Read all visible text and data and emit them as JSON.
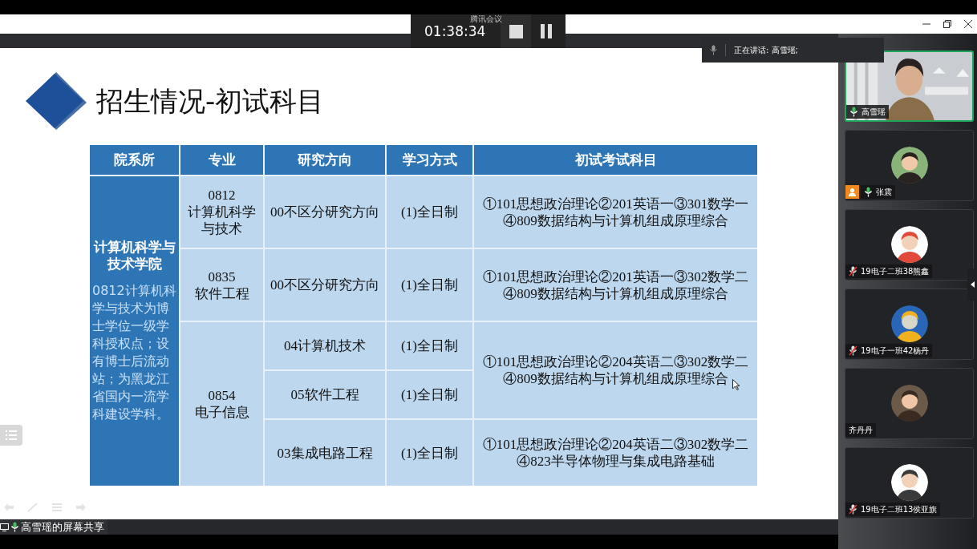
{
  "app_title": "腾讯会议",
  "timer": "01:38:34",
  "speaking_banner": "正在讲话: 高雪瑶;",
  "slide": {
    "title": "招生情况-初试科目",
    "table": {
      "columns": [
        "院系所",
        "专业",
        "研究方向",
        "学习方式",
        "初试考试科目"
      ],
      "department": {
        "name": "计算机科学与技术学院",
        "note": "0812计算机科学与技术为博士学位一级学科授权点；设有博士后流动站；为黑龙江省国内一流学科建设学科。"
      },
      "majors": [
        {
          "code": "0812",
          "name": "计算机科学与技术",
          "groups": [
            {
              "directions": [
                {
                  "name": "00不区分研究方向",
                  "mode": "(1)全日制"
                }
              ],
              "exam": [
                "①101思想政治理论②201英语一③301数学一",
                "④809数据结构与计算机组成原理综合"
              ]
            }
          ]
        },
        {
          "code": "0835",
          "name": "软件工程",
          "groups": [
            {
              "directions": [
                {
                  "name": "00不区分研究方向",
                  "mode": "(1)全日制"
                }
              ],
              "exam": [
                "①101思想政治理论②201英语一③302数学二",
                "④809数据结构与计算机组成原理综合"
              ]
            }
          ]
        },
        {
          "code": "0854",
          "name": "电子信息",
          "groups": [
            {
              "directions": [
                {
                  "name": "04计算机技术",
                  "mode": "(1)全日制"
                },
                {
                  "name": "05软件工程",
                  "mode": "(1)全日制"
                }
              ],
              "exam": [
                "①101思想政治理论②204英语二③302数学二",
                "④809数据结构与计算机组成原理综合"
              ]
            },
            {
              "directions": [
                {
                  "name": "03集成电路工程",
                  "mode": "(1)全日制"
                }
              ],
              "exam": [
                "①101思想政治理论②204英语二③302数学二",
                "④823半导体物理与集成电路基础"
              ]
            }
          ]
        }
      ]
    }
  },
  "share_label": "高雪瑶的屏幕共享",
  "participants": [
    {
      "name": "高雪瑶",
      "kind": "video",
      "mic": true,
      "muted": false,
      "host": false,
      "speaking": true
    },
    {
      "name": "张震",
      "kind": "avatar",
      "mic": true,
      "muted": false,
      "host": true,
      "speaking": false
    },
    {
      "name": "19电子二班38熊鑫",
      "kind": "avatar",
      "mic": true,
      "muted": true,
      "host": false,
      "speaking": false
    },
    {
      "name": "19电子一班42杨丹",
      "kind": "avatar",
      "mic": true,
      "muted": true,
      "host": false,
      "speaking": false
    },
    {
      "name": "齐丹丹",
      "kind": "avatar",
      "mic": false,
      "host": false,
      "speaking": false
    },
    {
      "name": "19电子二班13侯亚旗",
      "kind": "avatar",
      "mic": true,
      "muted": true,
      "host": false,
      "speaking": false
    }
  ]
}
